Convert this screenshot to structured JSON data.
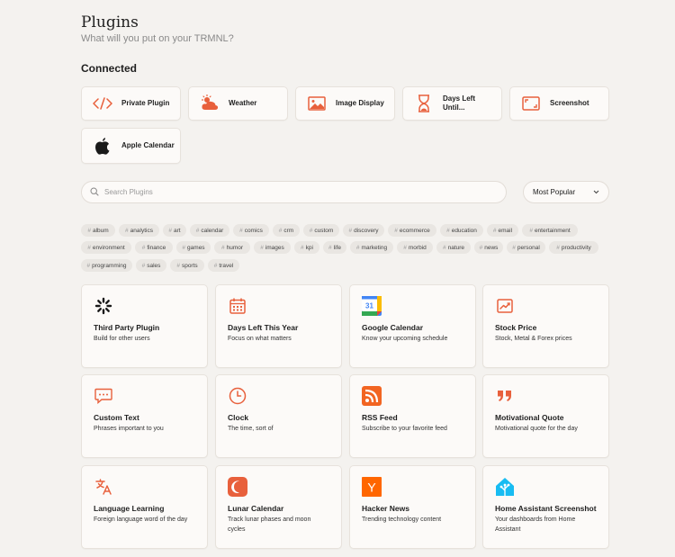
{
  "header": {
    "title": "Plugins",
    "subtitle": "What will you put on your TRMNL?"
  },
  "connected": {
    "title": "Connected",
    "items": [
      {
        "label": "Private Plugin",
        "icon": "code-icon"
      },
      {
        "label": "Weather",
        "icon": "weather-icon"
      },
      {
        "label": "Image Display",
        "icon": "image-icon"
      },
      {
        "label": "Days Left Until...",
        "icon": "hourglass-icon"
      },
      {
        "label": "Screenshot",
        "icon": "screenshot-icon"
      },
      {
        "label": "Apple Calendar",
        "icon": "apple-icon"
      }
    ]
  },
  "search": {
    "placeholder": "Search Plugins",
    "value": ""
  },
  "sort": {
    "selected": "Most Popular"
  },
  "tags": [
    "album",
    "analytics",
    "art",
    "calendar",
    "comics",
    "crm",
    "custom",
    "discovery",
    "ecommerce",
    "education",
    "email",
    "entertainment",
    "environment",
    "finance",
    "games",
    "humor",
    "images",
    "kpi",
    "life",
    "marketing",
    "morbid",
    "nature",
    "news",
    "personal",
    "productivity",
    "programming",
    "sales",
    "sports",
    "travel"
  ],
  "tag_prefix": "#",
  "plugins": [
    {
      "title": "Third Party Plugin",
      "desc": "Build for other users",
      "icon": "spinner-icon"
    },
    {
      "title": "Days Left This Year",
      "desc": "Focus on what matters",
      "icon": "calendar-grid-icon"
    },
    {
      "title": "Google Calendar",
      "desc": "Know your upcoming schedule",
      "icon": "google-calendar-icon"
    },
    {
      "title": "Stock Price",
      "desc": "Stock, Metal & Forex prices",
      "icon": "chart-icon"
    },
    {
      "title": "Custom Text",
      "desc": "Phrases important to you",
      "icon": "chat-bubble-icon"
    },
    {
      "title": "Clock",
      "desc": "The time, sort of",
      "icon": "clock-icon"
    },
    {
      "title": "RSS Feed",
      "desc": "Subscribe to your favorite feed",
      "icon": "rss-icon"
    },
    {
      "title": "Motivational Quote",
      "desc": "Motivational quote for the day",
      "icon": "quote-icon"
    },
    {
      "title": "Language Learning",
      "desc": "Foreign language word of the day",
      "icon": "translate-icon"
    },
    {
      "title": "Lunar Calendar",
      "desc": "Track lunar phases and moon cycles",
      "icon": "moon-icon"
    },
    {
      "title": "Hacker News",
      "desc": "Trending technology content",
      "icon": "hacker-news-icon"
    },
    {
      "title": "Home Assistant Screenshot",
      "desc": "Your dashboards from Home Assistant",
      "icon": "home-assistant-icon"
    }
  ],
  "colors": {
    "accent": "#e8603c",
    "background": "#f4f2ef",
    "card": "#fcfaf8"
  },
  "google_calendar_day": "31",
  "hacker_news_letter": "Y"
}
